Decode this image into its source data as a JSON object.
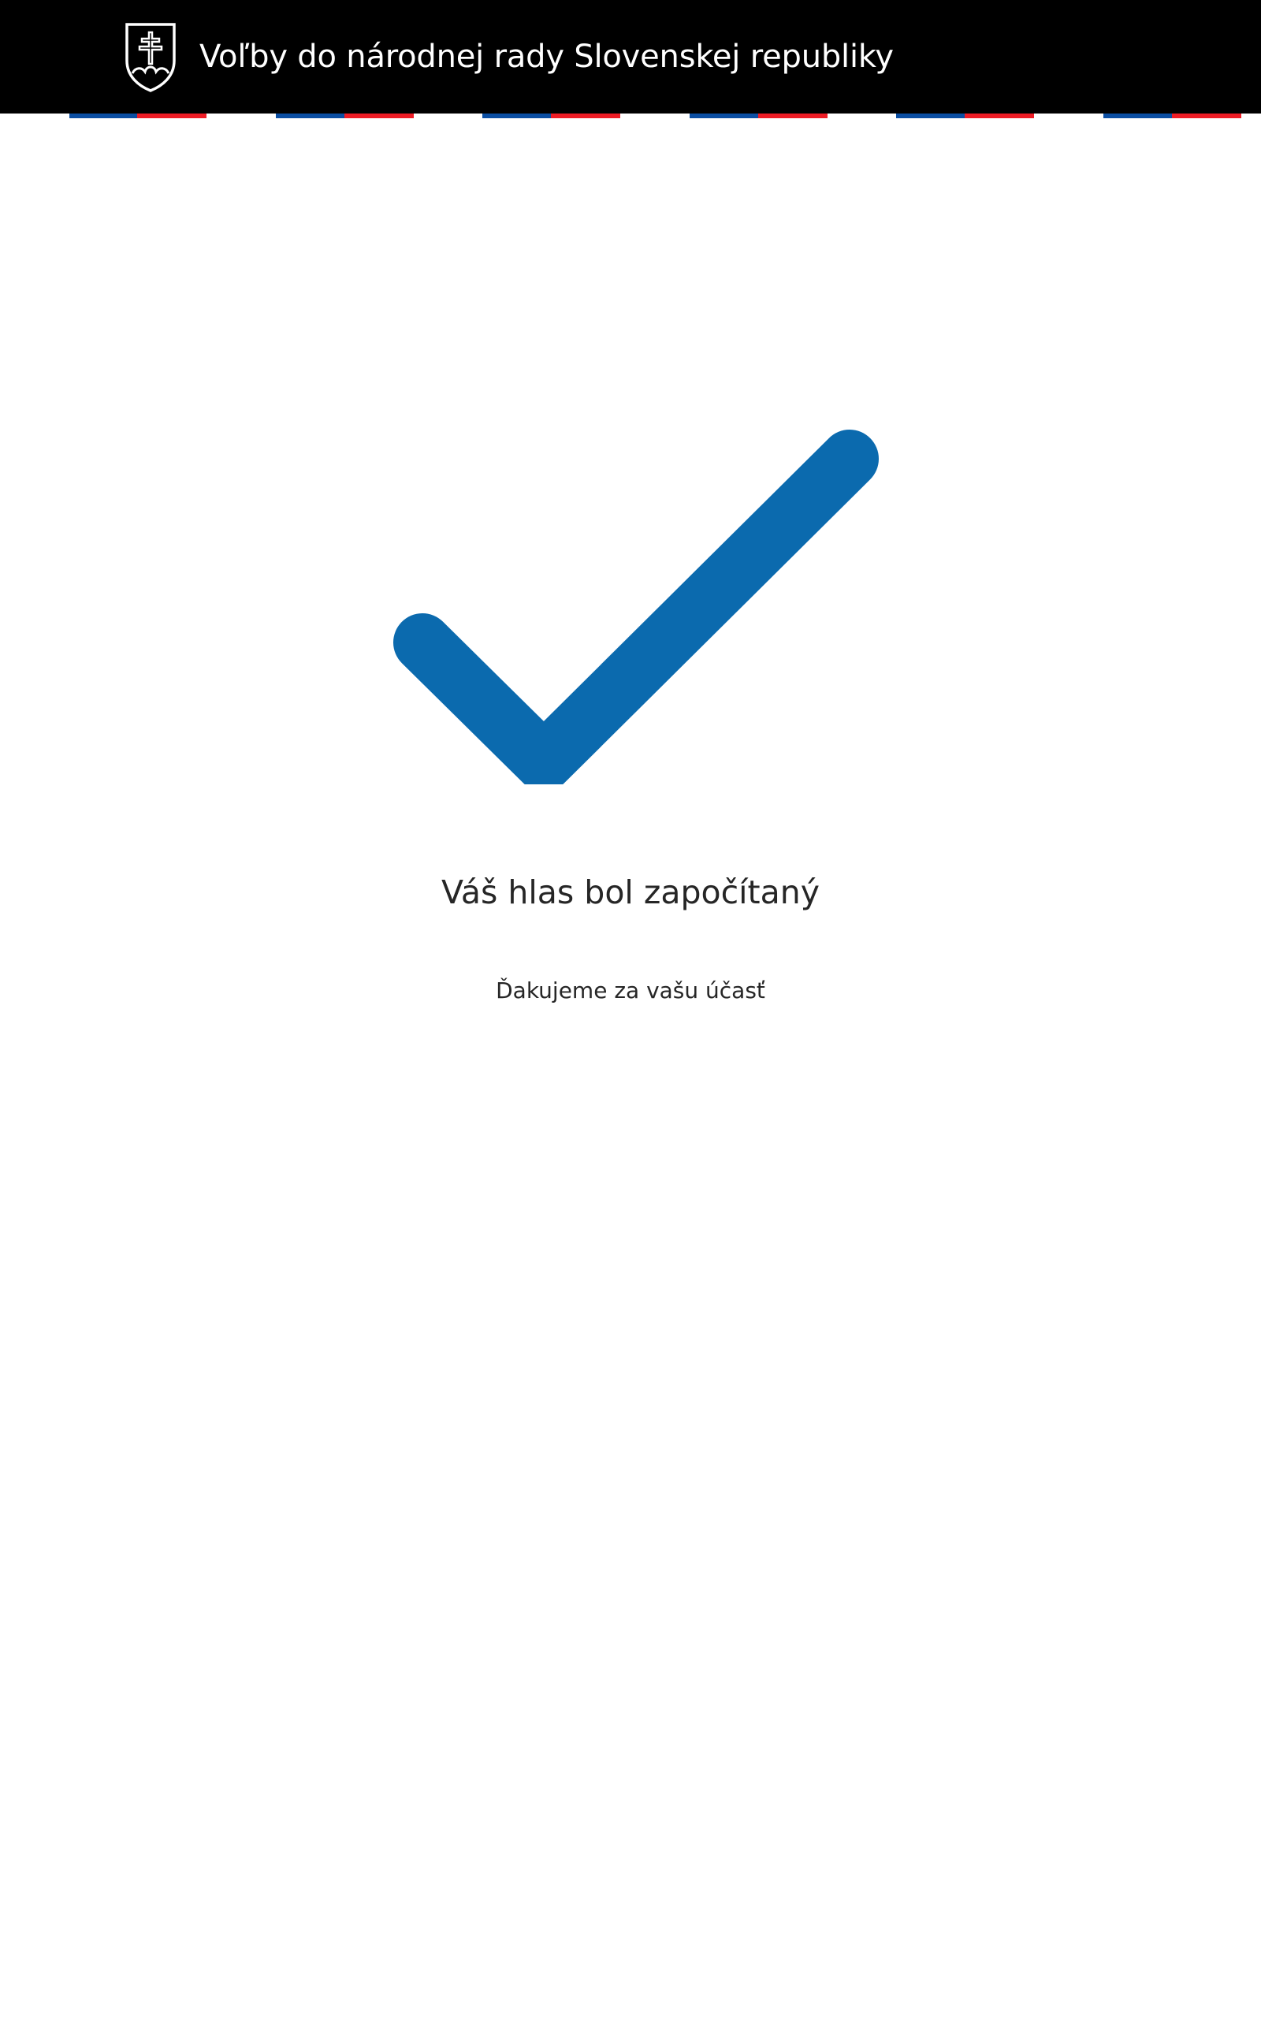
{
  "header": {
    "title": "Voľby do národnej rady Slovenskej republiky",
    "logo_icon": "slovak-coat-of-arms-icon"
  },
  "colors": {
    "header_bg": "#000000",
    "flag_blue": "#0b4ea2",
    "flag_red": "#ee1c25",
    "accent": "#0b6aae",
    "text": "#262626"
  },
  "main": {
    "status_icon": "checkmark-icon",
    "title": "Váš hlas bol započítaný",
    "subtitle": "Ďakujeme za vašu účasť"
  }
}
